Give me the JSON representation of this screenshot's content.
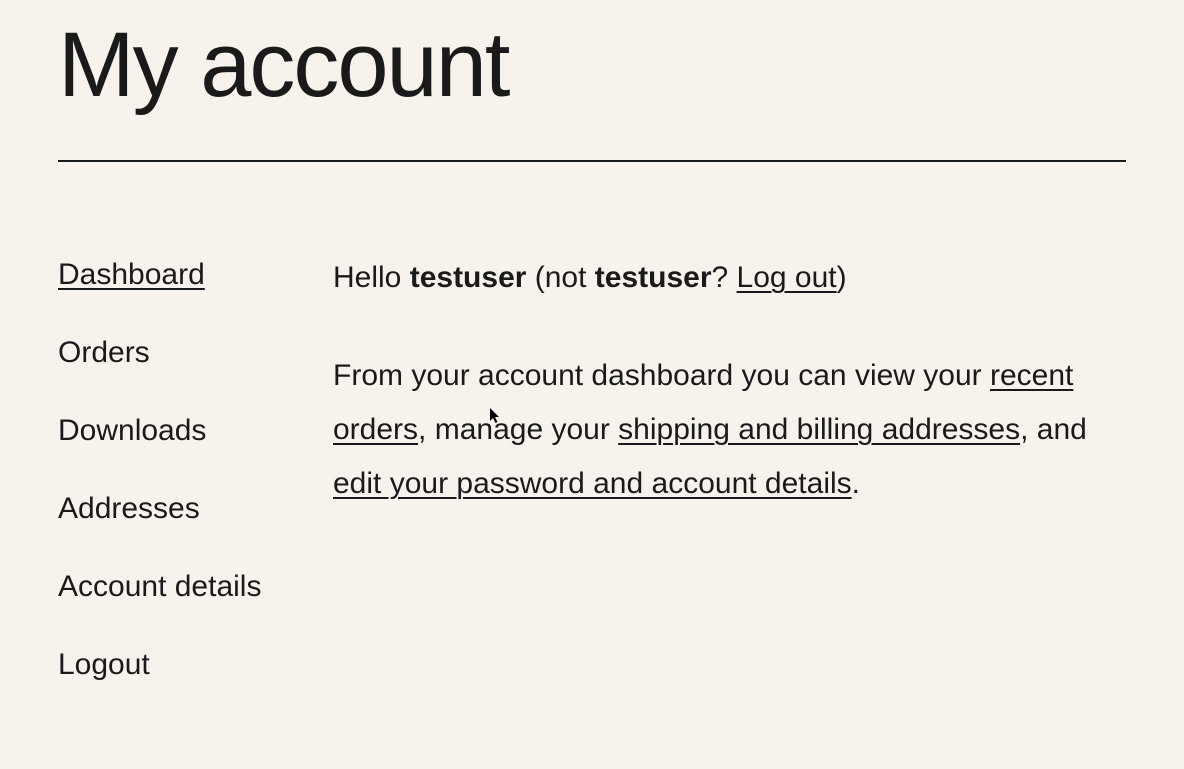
{
  "page": {
    "title": "My account"
  },
  "nav": {
    "items": [
      {
        "label": "Dashboard",
        "active": true
      },
      {
        "label": "Orders",
        "active": false
      },
      {
        "label": "Downloads",
        "active": false
      },
      {
        "label": "Addresses",
        "active": false
      },
      {
        "label": "Account details",
        "active": false
      },
      {
        "label": "Logout",
        "active": false
      }
    ]
  },
  "greeting": {
    "hello": "Hello ",
    "username": "testuser",
    "not_prefix": " (not ",
    "username2": "testuser",
    "question": "? ",
    "logout_link": "Log out",
    "closing": ")"
  },
  "description": {
    "part1": "From your account dashboard you can view your ",
    "link1": "recent orders",
    "part2": ", manage your ",
    "link2": "shipping and billing addresses",
    "part3": ", and ",
    "link3": "edit your password and account details",
    "part4": "."
  }
}
